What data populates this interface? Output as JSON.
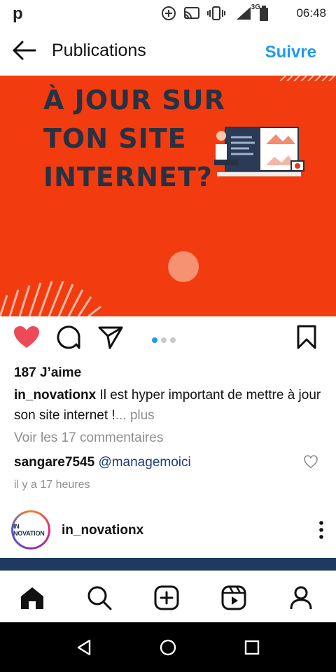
{
  "statusbar": {
    "app_letter": "p",
    "network": "3G",
    "time": "06:48",
    "icons": [
      "add-circle-icon",
      "cast-icon",
      "vibrate-icon",
      "signal-icon",
      "battery-icon"
    ]
  },
  "header": {
    "title": "Publications",
    "follow_label": "Suivre"
  },
  "post": {
    "headline": [
      "À JOUR SUR",
      "TON  SITE",
      "INTERNET?"
    ],
    "brand_color": "#f23c10",
    "headline_color": "#273142",
    "carousel": {
      "total": 3,
      "active": 1
    },
    "likes_text": "187 J’aime",
    "caption": {
      "user": "in_novationx",
      "text": " Il est hyper important de mettre à jour son site internet !",
      "more": "... plus"
    },
    "view_comments": "Voir les 17 commentaires",
    "comment": {
      "user": "sangare7545",
      "mention": "@managemoici"
    },
    "time_ago": "il y a 17 heures",
    "liked": true
  },
  "next_post": {
    "username": "in_novationx",
    "avatar_text": "IN NOVATION"
  },
  "bottom_nav": [
    "home-icon",
    "search-icon",
    "create-icon",
    "reels-icon",
    "profile-icon"
  ],
  "accent_color": "#1d9bf0"
}
